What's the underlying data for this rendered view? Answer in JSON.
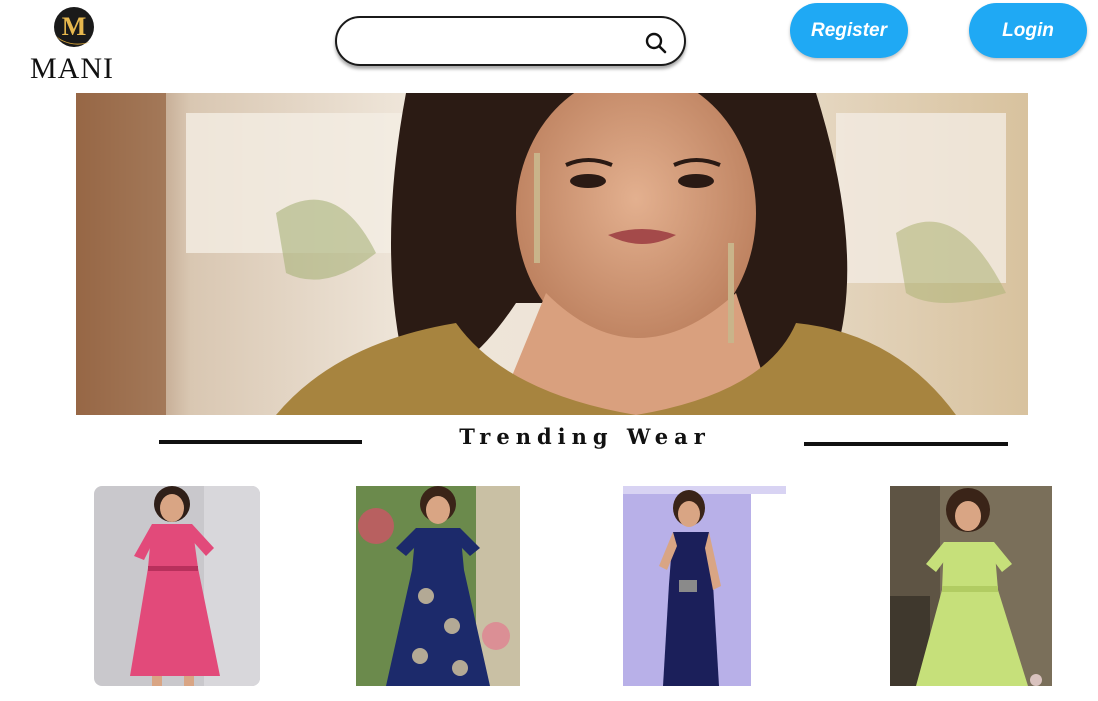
{
  "brand": {
    "logo_text": "MANI",
    "logo_mark": "M"
  },
  "search": {
    "placeholder": "",
    "value": "",
    "icon": "search-icon"
  },
  "header": {
    "register_label": "Register",
    "login_label": "Login"
  },
  "section": {
    "title": "Trending Wear"
  },
  "colors": {
    "accent": "#1fa9f4",
    "gold": "#d7a33a",
    "text": "#111111"
  },
  "products": [
    {
      "dress_color": "#e24a7a",
      "bg": "#c9c8cc"
    },
    {
      "dress_color": "#1c2a6b",
      "bg": "#6b8a4c"
    },
    {
      "dress_color": "#1b1f5a",
      "bg": "#b8b0e8"
    },
    {
      "dress_color": "#c6e07a",
      "bg": "#7a6f5a"
    }
  ]
}
